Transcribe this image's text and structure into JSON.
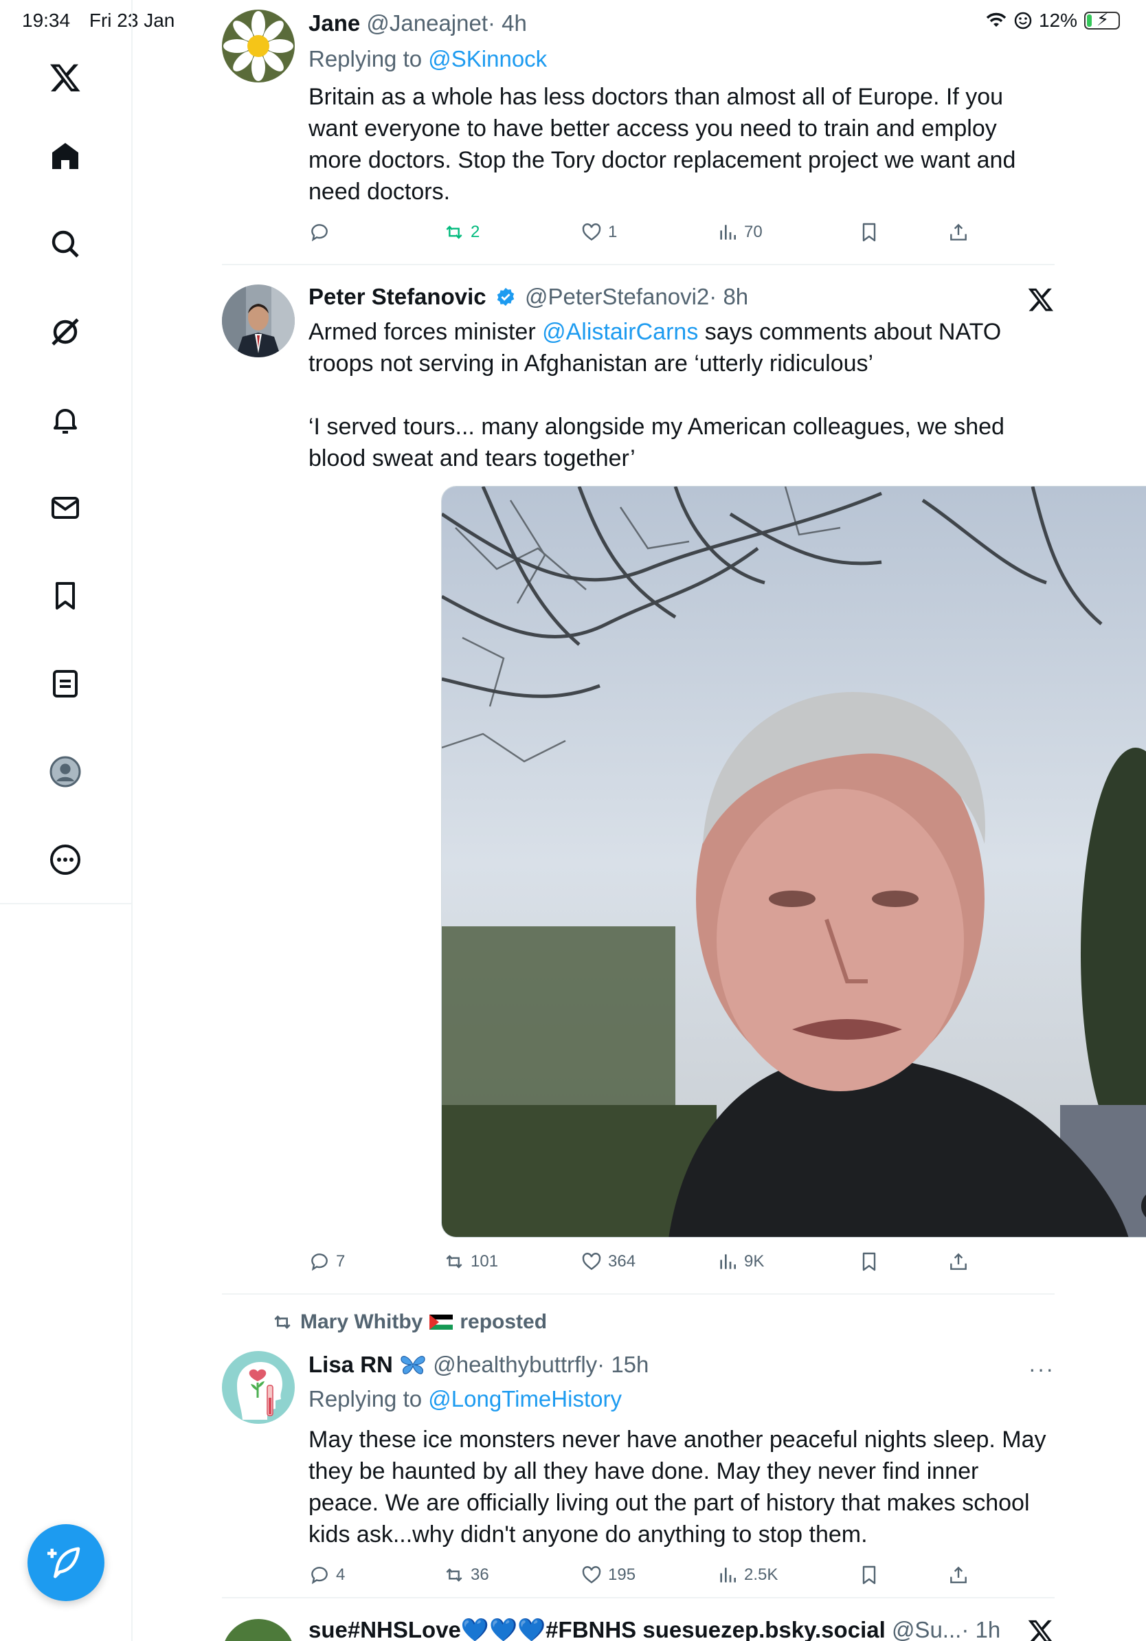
{
  "status": {
    "time": "19:34",
    "date": "Fri 23 Jan",
    "battery": "12%"
  },
  "sidebar": {
    "items": [
      "x-logo-icon",
      "home-icon",
      "search-icon",
      "grok-icon",
      "notifications-icon",
      "messages-icon",
      "bookmarks-icon",
      "lists-icon",
      "profile-icon",
      "more-icon"
    ]
  },
  "tweets": [
    {
      "name": "Jane",
      "handle": "@Janeajnet",
      "time": "· 4h",
      "replying_prefix": "Replying to ",
      "replying_to": "@SKinnock",
      "text": "Britain as a whole has less doctors than almost all of Europe. If you want everyone to have better access you need to train and employ more doctors. Stop the Tory doctor replacement project we want and need doctors.",
      "replies": "",
      "reposts": "2",
      "likes": "1",
      "views": "70"
    },
    {
      "name": "Peter Stefanovic",
      "handle": "@PeterStefanovi2",
      "time": "· 8h",
      "text_pre": "Armed forces minister ",
      "mention": "@AlistairCarns",
      "text_post": " says comments about NATO troops not serving in Afghanistan are ‘utterly ridiculous’",
      "text2": "‘I served tours... many alongside my American colleagues, we shed blood sweat and tears together’",
      "replies": "7",
      "reposts": "101",
      "likes": "364",
      "views": "9K"
    },
    {
      "reposted_by": "Mary Whitby",
      "reposted_label": "reposted",
      "name": "Lisa RN",
      "handle": "@healthybuttrfly",
      "time": "· 15h",
      "replying_prefix": "Replying to ",
      "replying_to": "@LongTimeHistory",
      "text": "May these ice monsters never have another peaceful nights sleep. May they be haunted by all they have done. May they never find inner peace. We are officially living out the part of history that makes school kids ask...why didn't anyone do anything to stop them.",
      "replies": "4",
      "reposts": "36",
      "likes": "195",
      "views": "2.5K"
    },
    {
      "name": "sue#NHSLove💙💙💙#FBNHS suesuezep.bsky.social",
      "handle": "@Su...",
      "time": "· 1h"
    }
  ],
  "colors": {
    "accent": "#1d9bf0",
    "repost_green": "#00ba7c",
    "muted": "#536471"
  }
}
